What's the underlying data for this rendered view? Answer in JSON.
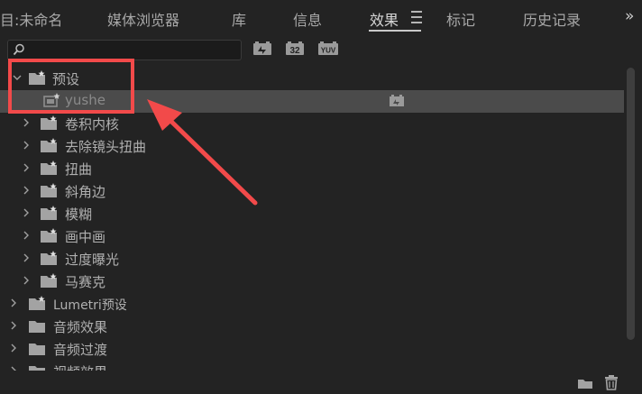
{
  "tabs": [
    {
      "label": "目:未命名",
      "active": false
    },
    {
      "label": "媒体浏览器",
      "active": false
    },
    {
      "label": "库",
      "active": false
    },
    {
      "label": "信息",
      "active": false
    },
    {
      "label": "效果",
      "active": true
    },
    {
      "label": "标记",
      "active": false
    },
    {
      "label": "历史记录",
      "active": false
    }
  ],
  "more_label": "»",
  "search": {
    "value": "",
    "placeholder": ""
  },
  "toolbar": {
    "accelerated_label": "",
    "bit32_label": "32",
    "yuv_label": "YUV"
  },
  "tree": {
    "presets": {
      "label": "预设",
      "child": "yushe"
    },
    "items": [
      {
        "label": "卷积内核"
      },
      {
        "label": "去除镜头扭曲"
      },
      {
        "label": "扭曲"
      },
      {
        "label": "斜角边"
      },
      {
        "label": "模糊"
      },
      {
        "label": "画中画"
      },
      {
        "label": "过度曝光"
      },
      {
        "label": "马赛克"
      }
    ],
    "root_items": [
      {
        "label": "Lumetri预设"
      },
      {
        "label": "音频效果"
      },
      {
        "label": "音频过渡"
      },
      {
        "label": "视频效果"
      }
    ]
  },
  "colors": {
    "annotation": "#f24a4a",
    "panel_bg": "#232323",
    "selected_row": "#4b4b4b"
  }
}
